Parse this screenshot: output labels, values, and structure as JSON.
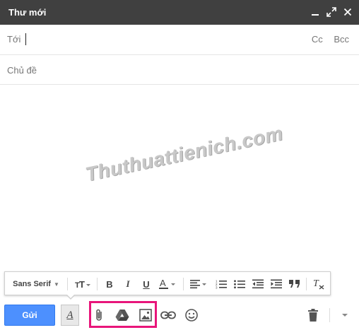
{
  "window": {
    "title": "Thư mới",
    "minimize_icon": "minimize-icon",
    "popout_icon": "popout-icon",
    "close_icon": "close-icon"
  },
  "recipients": {
    "to_label": "Tới",
    "cc_label": "Cc",
    "bcc_label": "Bcc"
  },
  "subject": {
    "placeholder": "Chủ đề",
    "value": ""
  },
  "body": {
    "watermark": "Thuthuattienich.com"
  },
  "format_toolbar": {
    "font_name": "Sans Serif",
    "items": [
      "font-size-icon",
      "bold-icon",
      "italic-icon",
      "underline-icon",
      "text-color-icon",
      "align-icon",
      "numbered-list-icon",
      "bulleted-list-icon",
      "indent-less-icon",
      "indent-more-icon",
      "quote-icon",
      "remove-formatting-icon"
    ]
  },
  "bottom_bar": {
    "send_label": "Gửi",
    "format_toggle_label": "A",
    "attach_icon": "paperclip-icon",
    "drive_icon": "drive-icon",
    "photo_icon": "photo-icon",
    "link_icon": "link-icon",
    "emoji_icon": "emoji-icon",
    "discard_icon": "trash-icon",
    "more_icon": "chevron-down-icon"
  },
  "colors": {
    "titlebar": "#404040",
    "send_button": "#4d90fe",
    "highlight": "#e8157a",
    "watermark": "#bfbfbf"
  }
}
